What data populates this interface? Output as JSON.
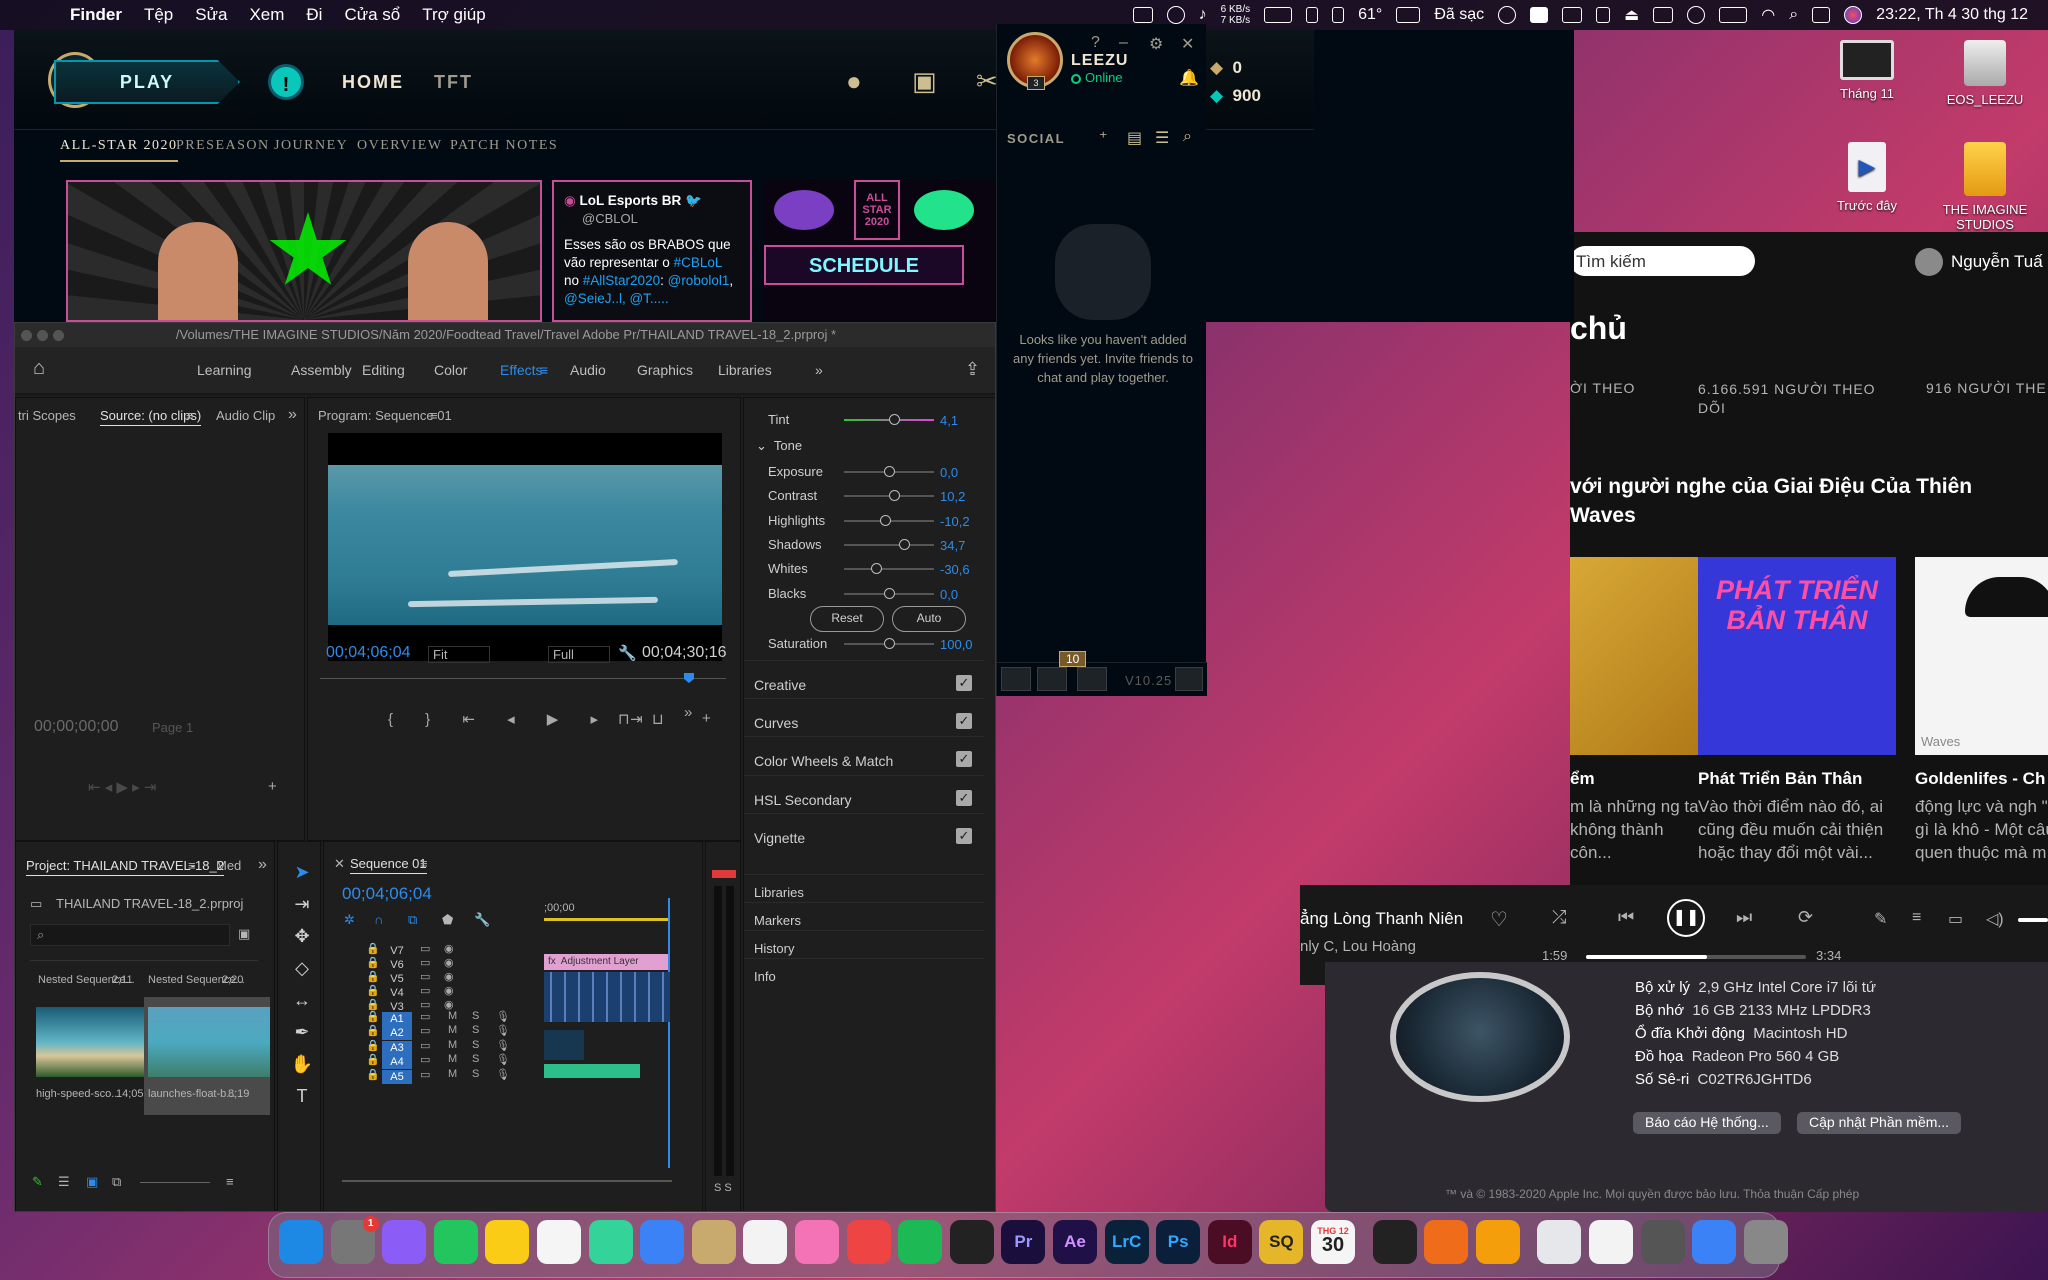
{
  "menubar": {
    "app": "Finder",
    "menus": [
      "Tệp",
      "Sửa",
      "Xem",
      "Đi",
      "Cửa sổ",
      "Trợ giúp"
    ],
    "net_up": "6 KB/s",
    "net_down": "7 KB/s",
    "temperature": "61°",
    "battery": "Đã sạc",
    "clock": "23:22, Th 4 30 thg 12"
  },
  "desktop": {
    "icons": [
      {
        "label": "Tháng 11",
        "icon": "screenshot-file-icon"
      },
      {
        "label": "EOS_LEEZU",
        "icon": "external-drive-icon"
      },
      {
        "label": "Trước đây",
        "icon": "mov-file-icon"
      },
      {
        "label": "THE IMAGINE STUDIOS",
        "icon": "external-drive-icon"
      }
    ]
  },
  "lol": {
    "play": "PLAY",
    "nav": [
      "HOME",
      "TFT"
    ],
    "currency": {
      "rp": "0",
      "be": "900"
    },
    "subnav": [
      "ALL-STAR 2020",
      "PRESEASON",
      "JOURNEY",
      "OVERVIEW",
      "PATCH NOTES"
    ],
    "tweet": {
      "author": "LoL Esports BR",
      "handle": "@CBLOL",
      "text_a": "Esses são os BRABOS que vão representar o ",
      "tag1": "#CBLoL",
      "text_b": " no ",
      "tag2": "#AllStar2020",
      "text_c": ": ",
      "mention": "@robolol1",
      "more": "@SeieJ..l, @T....."
    },
    "schedule": "SCHEDULE",
    "banner_logo": "ALL STAR 2020",
    "social": {
      "name": "LEEZU",
      "status": "Online",
      "level": "3",
      "heading": "SOCIAL",
      "empty_msg": "Looks like you haven't added any friends yet. Invite friends to chat and play together.",
      "badge": "10",
      "version": "V10.25"
    }
  },
  "premiere": {
    "title": "/Volumes/THE IMAGINE STUDIOS/Năm 2020/Foodtead Travel/Travel Adobe Pr/THAILAND TRAVEL-18_2.prproj *",
    "workspaces": [
      "Learning",
      "Assembly",
      "Editing",
      "Color",
      "Effects",
      "Audio",
      "Graphics",
      "Libraries"
    ],
    "active_workspace": "Effects",
    "source": {
      "tabs": [
        "tri Scopes",
        "Source: (no clips)",
        "Audio Clip"
      ],
      "timecode": "00;00;00;00",
      "page": "Page 1"
    },
    "program": {
      "tab": "Program: Sequence 01",
      "timecode": "00;04;06;04",
      "fit": "Fit",
      "quality": "Full",
      "duration": "00;04;30;16"
    },
    "lumetri": {
      "tint": {
        "label": "Tint",
        "value": "4,1",
        "pos": 0.55
      },
      "tone_header": "Tone",
      "rows": [
        {
          "label": "Exposure",
          "value": "0,0",
          "pos": 0.5
        },
        {
          "label": "Contrast",
          "value": "10,2",
          "pos": 0.55
        },
        {
          "label": "Highlights",
          "value": "-10,2",
          "pos": 0.45
        },
        {
          "label": "Shadows",
          "value": "34,7",
          "pos": 0.67
        },
        {
          "label": "Whites",
          "value": "-30,6",
          "pos": 0.35
        },
        {
          "label": "Blacks",
          "value": "0,0",
          "pos": 0.5
        }
      ],
      "reset": "Reset",
      "auto": "Auto",
      "saturation": {
        "label": "Saturation",
        "value": "100,0",
        "pos": 0.5
      },
      "sections": [
        "Creative",
        "Curves",
        "Color Wheels & Match",
        "HSL Secondary",
        "Vignette"
      ],
      "panels": [
        "Libraries",
        "Markers",
        "History",
        "Info"
      ]
    },
    "project": {
      "tab": "Project: THAILAND TRAVEL-18_2",
      "tab2": "Med",
      "file": "THAILAND TRAVEL-18_2.prproj",
      "bins": [
        {
          "name": "Nested Sequence...",
          "dur": "2;11"
        },
        {
          "name": "Nested Sequence...",
          "dur": "2;20"
        }
      ],
      "clips": [
        {
          "name": "high-speed-sco...",
          "dur": "14;05"
        },
        {
          "name": "launches-float-b...",
          "dur": "8;19"
        }
      ]
    },
    "timeline": {
      "tab": "Sequence 01",
      "timecode": "00;04;06;04",
      "ruler": ";00;00",
      "video_tracks": [
        "V7",
        "V6",
        "V5",
        "V4",
        "V3"
      ],
      "audio_tracks": [
        "A1",
        "A2",
        "A3",
        "A4",
        "A5"
      ],
      "adjustment": "Adjustment Layer",
      "fx": "fx",
      "m": "M",
      "s": "S"
    }
  },
  "spotify": {
    "search": "Tìm kiếm",
    "user": "Nguyễn Tuấ",
    "heading": "chủ",
    "stats": [
      "ỜI THEO",
      "6.166.591 NGƯỜI THEO DÕI",
      "916 NGƯỜI THE"
    ],
    "section": "với người nghe của Giai Điệu Của Thiên Waves",
    "cards": [
      {
        "title": "ểm",
        "desc": "m là những ng ta không thành côn..."
      },
      {
        "title": "Phát Triển Bản Thân",
        "desc": "Vào thời điểm nào đó, ai cũng đều muốn cải thiện hoặc thay đổi một vài...",
        "cover_text": "PHÁT TRIỂN BẢN THÂN"
      },
      {
        "title": "Goldenlifes - Ch",
        "desc": "động lực và ngh \"Không gì là khô - Một câu châm quen thuộc mà m",
        "cover_text": "Waves"
      }
    ],
    "player": {
      "song": "ẳng Lòng Thanh Niên",
      "artist": "nly C, Lou Hoàng",
      "elapsed": "1:59",
      "total": "3:34",
      "progress": 0.55
    }
  },
  "about_mac": {
    "specs": [
      {
        "k": "Bộ xử lý",
        "v": "2,9 GHz Intel Core i7 lõi tứ"
      },
      {
        "k": "Bộ nhớ",
        "v": "16 GB 2133 MHz LPDDR3"
      },
      {
        "k": "Ổ đĩa Khởi động",
        "v": "Macintosh HD"
      },
      {
        "k": "Đồ họa",
        "v": "Radeon Pro 560 4 GB"
      },
      {
        "k": "Số Sê-ri",
        "v": "C02TR6JGHTD6"
      }
    ],
    "btn_report": "Báo cáo Hệ thống...",
    "btn_update": "Cập nhật Phần mềm...",
    "footer": "™ và © 1983-2020 Apple Inc. Mọi quyền được bảo lưu. Thỏa thuận Cấp phép"
  },
  "dock": {
    "apps": [
      "Finder",
      "System Preferences",
      "Siri",
      "FaceTime",
      "Notes",
      "Reminders",
      "Maps",
      "App Store",
      "League of Legends",
      "Chrome",
      "Photos",
      "Launchpad",
      "Spotify",
      "Final Cut",
      "Pr",
      "Ae",
      "LrC",
      "Ps",
      "Id",
      "SQ",
      "Calendar",
      "Terminal",
      "Garena",
      "Rocket",
      "Document",
      "Files",
      "Screenshots",
      "Folder",
      "Trash"
    ],
    "calendar_day": "30",
    "calendar_month": "THG 12",
    "sysprefs_badge": "1"
  }
}
